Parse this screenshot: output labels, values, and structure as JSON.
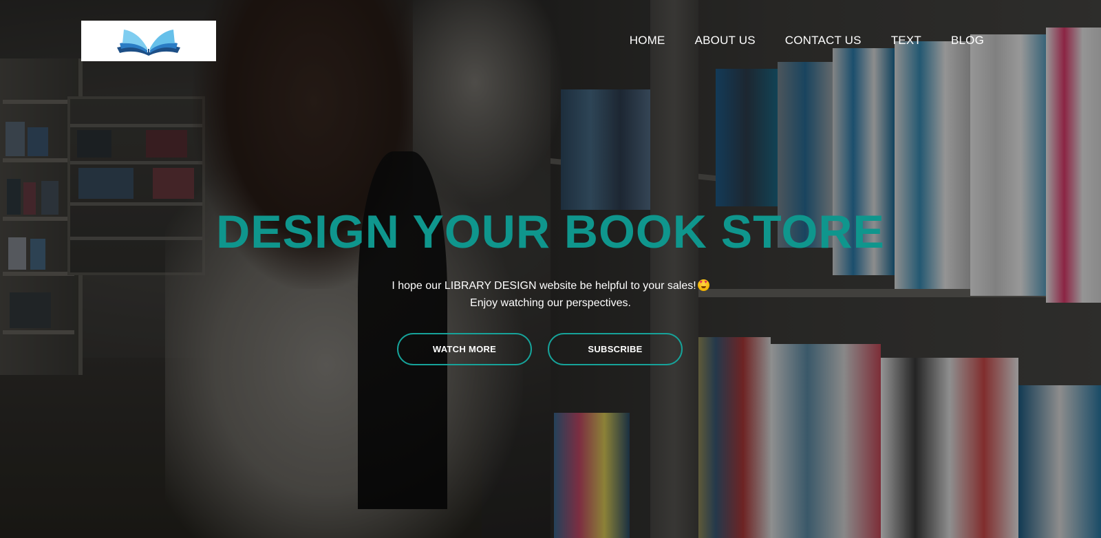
{
  "header": {
    "logo_icon": "open-book-icon",
    "nav": [
      {
        "label": "HOME"
      },
      {
        "label": "ABOUT US"
      },
      {
        "label": "CONTACT US"
      },
      {
        "label": "TEXT"
      },
      {
        "label": "BLOG"
      }
    ]
  },
  "hero": {
    "title": "DESIGN YOUR BOOK STORE",
    "subtitle_line1": "I hope our LIBRARY DESIGN website be helpful to your sales!",
    "subtitle_emoji": "star-struck-emoji-icon",
    "subtitle_line2": "Enjoy watching our perspectives.",
    "buttons": {
      "watch_more": "WATCH MORE",
      "subscribe": "SUBSCRIBE"
    }
  },
  "colors": {
    "accent": "#0f968d",
    "button_border": "#16a39a",
    "text": "#ffffff",
    "logo_bg": "#ffffff"
  }
}
